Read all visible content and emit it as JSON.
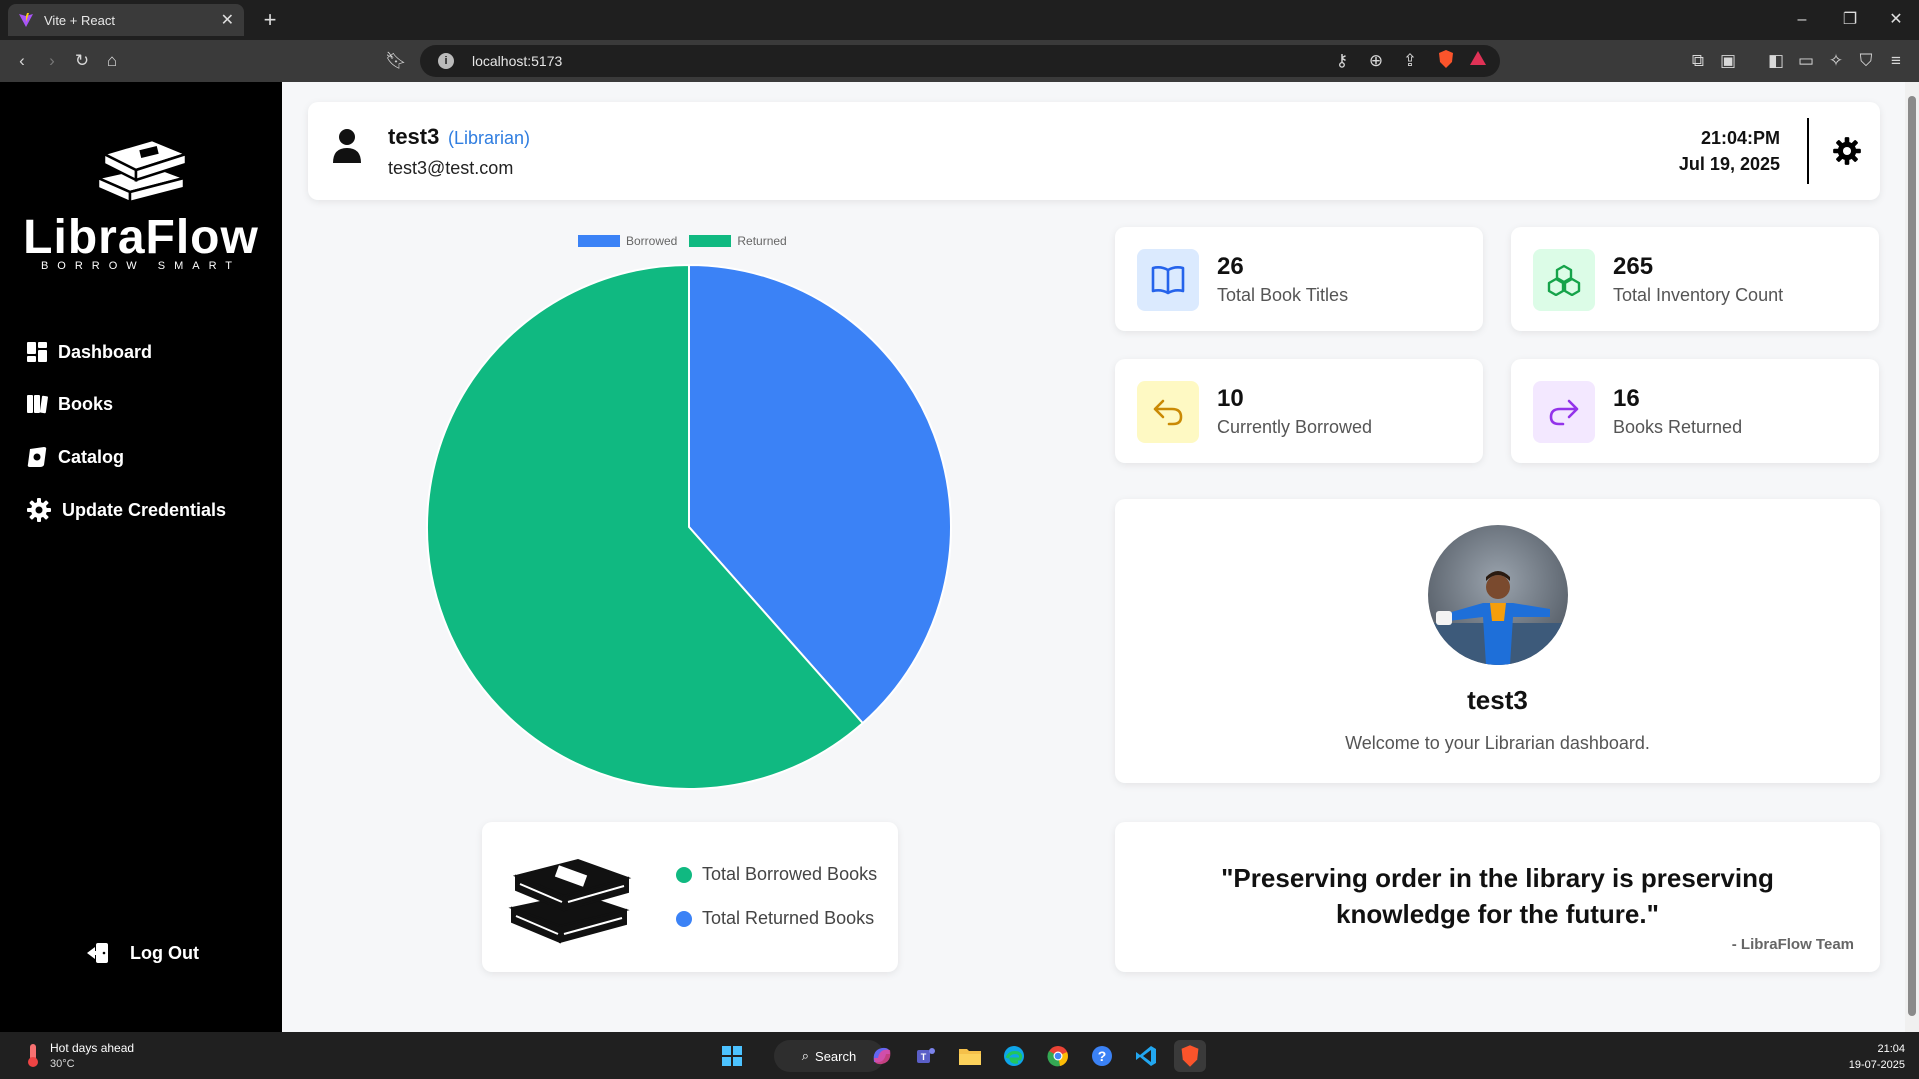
{
  "browser": {
    "tab_title": "Vite + React",
    "url": "localhost:5173"
  },
  "sidebar": {
    "brand": "LibraFlow",
    "tagline": "BORROW SMART",
    "items": [
      {
        "label": "Dashboard",
        "icon": "dashboard-icon"
      },
      {
        "label": "Books",
        "icon": "books-icon"
      },
      {
        "label": "Catalog",
        "icon": "catalog-icon"
      },
      {
        "label": "Update Credentials",
        "icon": "gear-icon"
      }
    ],
    "logout": "Log Out"
  },
  "header": {
    "username": "test3",
    "role": "(Librarian)",
    "email": "test3@test.com",
    "time": "21:04:PM",
    "date": "Jul 19, 2025"
  },
  "chart_data": {
    "type": "pie",
    "categories": [
      "Borrowed",
      "Returned"
    ],
    "values": [
      10,
      16
    ],
    "colors": [
      "#3b82f6",
      "#10b981"
    ],
    "legend": "top"
  },
  "stats": [
    {
      "value": "26",
      "label": "Total Book Titles",
      "icon": "open-book-icon",
      "bg": "#dbeafe",
      "color": "#2563eb"
    },
    {
      "value": "265",
      "label": "Total Inventory Count",
      "icon": "cubes-icon",
      "bg": "#dcfce7",
      "color": "#16a34a"
    },
    {
      "value": "10",
      "label": "Currently Borrowed",
      "icon": "undo-arrow-icon",
      "bg": "#fef9c3",
      "color": "#ca8a04"
    },
    {
      "value": "16",
      "label": "Books Returned",
      "icon": "redo-arrow-icon",
      "bg": "#f3e8ff",
      "color": "#9333ea"
    }
  ],
  "profile": {
    "name": "test3",
    "welcome": "Welcome to your Librarian dashboard."
  },
  "legend_card": {
    "borrowed": "Total Borrowed Books",
    "returned": "Total Returned Books"
  },
  "quote": {
    "text": "\"Preserving order in the library is preserving knowledge for the future.\"",
    "author": "- LibraFlow Team"
  },
  "taskbar": {
    "weather_title": "Hot days ahead",
    "weather_temp": "30°C",
    "search": "Search",
    "time": "21:04",
    "date": "19-07-2025"
  }
}
